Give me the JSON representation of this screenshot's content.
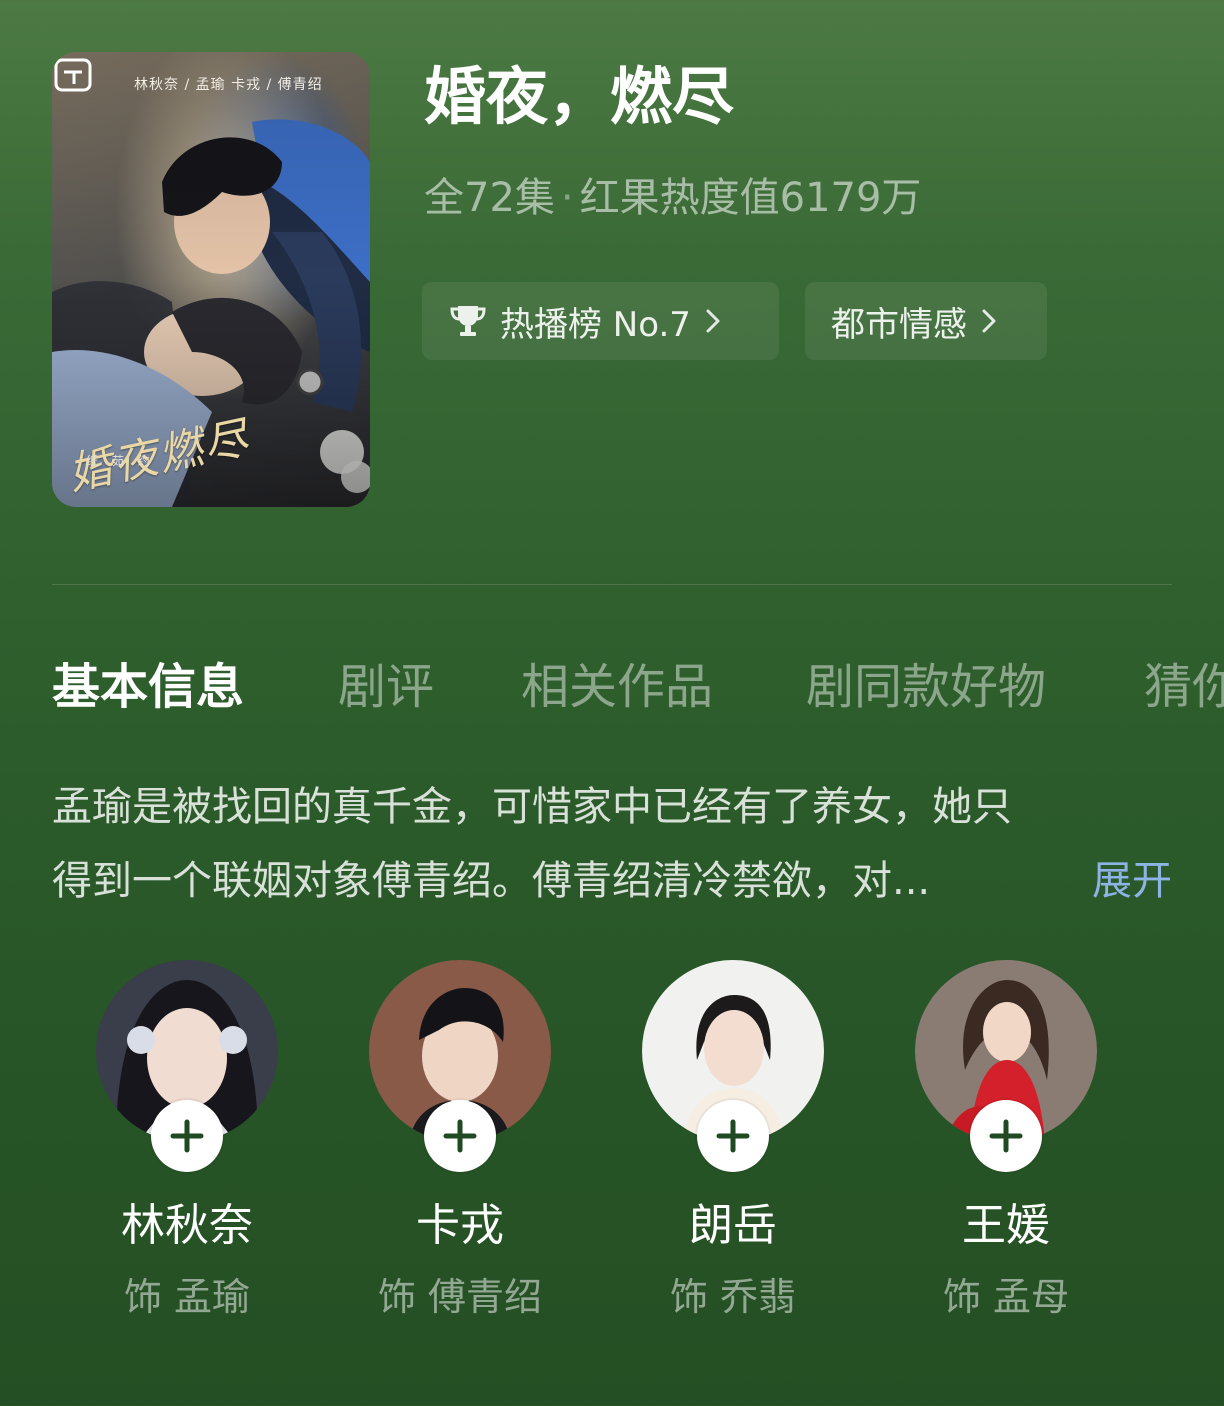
{
  "poster": {
    "credits": "林秋奈 / 孟瑜    卡戎 / 傅青绍",
    "calligraphy": "婚夜燃尽",
    "small_text": "纸 茹 约"
  },
  "drama": {
    "title": "婚夜，燃尽",
    "episodes": "全72集",
    "separator": "·",
    "heat": "红果热度值6179万"
  },
  "chips": {
    "rank_label": "热播榜 No.7",
    "genre_label": "都市情感"
  },
  "tabs": [
    {
      "label": "基本信息"
    },
    {
      "label": "剧评"
    },
    {
      "label": "相关作品"
    },
    {
      "label": "剧同款好物"
    },
    {
      "label": "猜你"
    }
  ],
  "synopsis": {
    "line1": "孟瑜是被找回的真千金，可惜家中已经有了养女，她只",
    "line2": "得到一个联姻对象傅青绍。傅青绍清冷禁欲，对...",
    "expand_label": "展开"
  },
  "cast": [
    {
      "name": "林秋奈",
      "role": "饰 孟瑜"
    },
    {
      "name": "卡戎",
      "role": "饰 傅青绍"
    },
    {
      "name": "朗岳",
      "role": "饰 乔翡"
    },
    {
      "name": "王媛",
      "role": "饰 孟母"
    }
  ],
  "colors": {
    "background_top": "#4d7a44",
    "background_bottom": "#244f24",
    "expand_link": "#8eb4e6"
  }
}
